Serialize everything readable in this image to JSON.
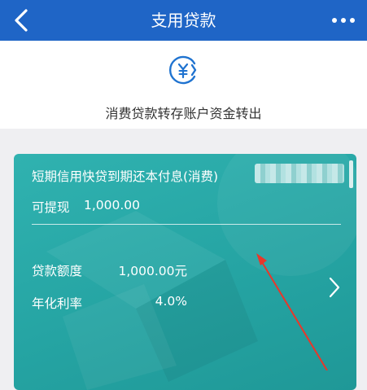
{
  "nav": {
    "title": "支用贷款",
    "back_icon": "chevron-left-icon",
    "more_icon": "more-dots-icon"
  },
  "header": {
    "icon": "yen-transfer-icon",
    "subtitle": "消费贷款转存账户资金转出"
  },
  "loan_card": {
    "title": "短期信用快贷到期还本付息(消费)",
    "available_label": "可提现",
    "available_value": "1,000.00",
    "amount_label": "贷款额度",
    "amount_value": "1,000.00元",
    "rate_label": "年化利率",
    "rate_value": "4.0%",
    "arrow_icon": "chevron-right-icon"
  },
  "colors": {
    "nav_bg": "#1f65c6",
    "card_bg": "#29a9a8",
    "icon_blue": "#1f73d0",
    "annotation_red": "#e8372a"
  }
}
